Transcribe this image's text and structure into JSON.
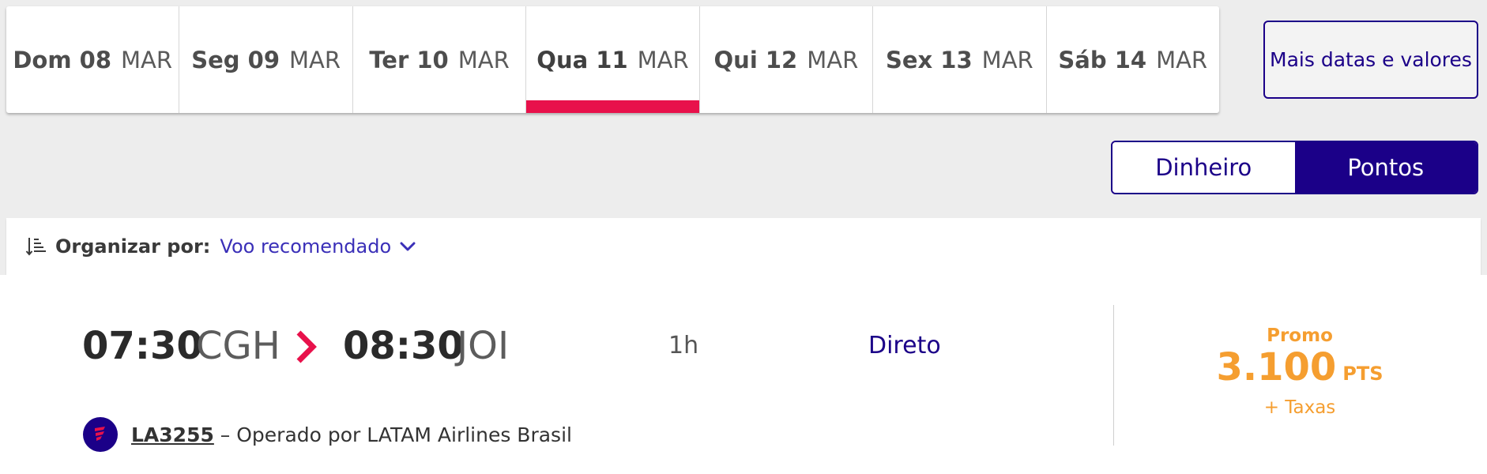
{
  "dates": [
    {
      "day": "Dom 08",
      "month": "MAR",
      "active": false
    },
    {
      "day": "Seg 09",
      "month": "MAR",
      "active": false
    },
    {
      "day": "Ter 10",
      "month": "MAR",
      "active": false
    },
    {
      "day": "Qua 11",
      "month": "MAR",
      "active": true
    },
    {
      "day": "Qui 12",
      "month": "MAR",
      "active": false
    },
    {
      "day": "Sex 13",
      "month": "MAR",
      "active": false
    },
    {
      "day": "Sáb 14",
      "month": "MAR",
      "active": false
    }
  ],
  "more_dates_label": "Mais datas e valores",
  "currency_toggle": {
    "money_label": "Dinheiro",
    "points_label": "Pontos",
    "selected": "Pontos"
  },
  "sort": {
    "label": "Organizar por:",
    "value": "Voo recomendado",
    "icon": "sort-icon"
  },
  "flight": {
    "departure_time": "07:30",
    "departure_airport": "CGH",
    "arrival_time": "08:30",
    "arrival_airport": "JOI",
    "duration": "1h",
    "stops": "Direto",
    "fare_label": "Promo",
    "points": "3.100",
    "points_unit": "PTS",
    "taxes": "+ Taxas",
    "flight_number": "LA3255",
    "operated_by": " – Operado por LATAM Airlines Brasil"
  },
  "colors": {
    "brand_indigo": "#1b0088",
    "accent_pink": "#e8114b",
    "price_orange": "#f59e30",
    "link_blue": "#3a2fb8"
  }
}
